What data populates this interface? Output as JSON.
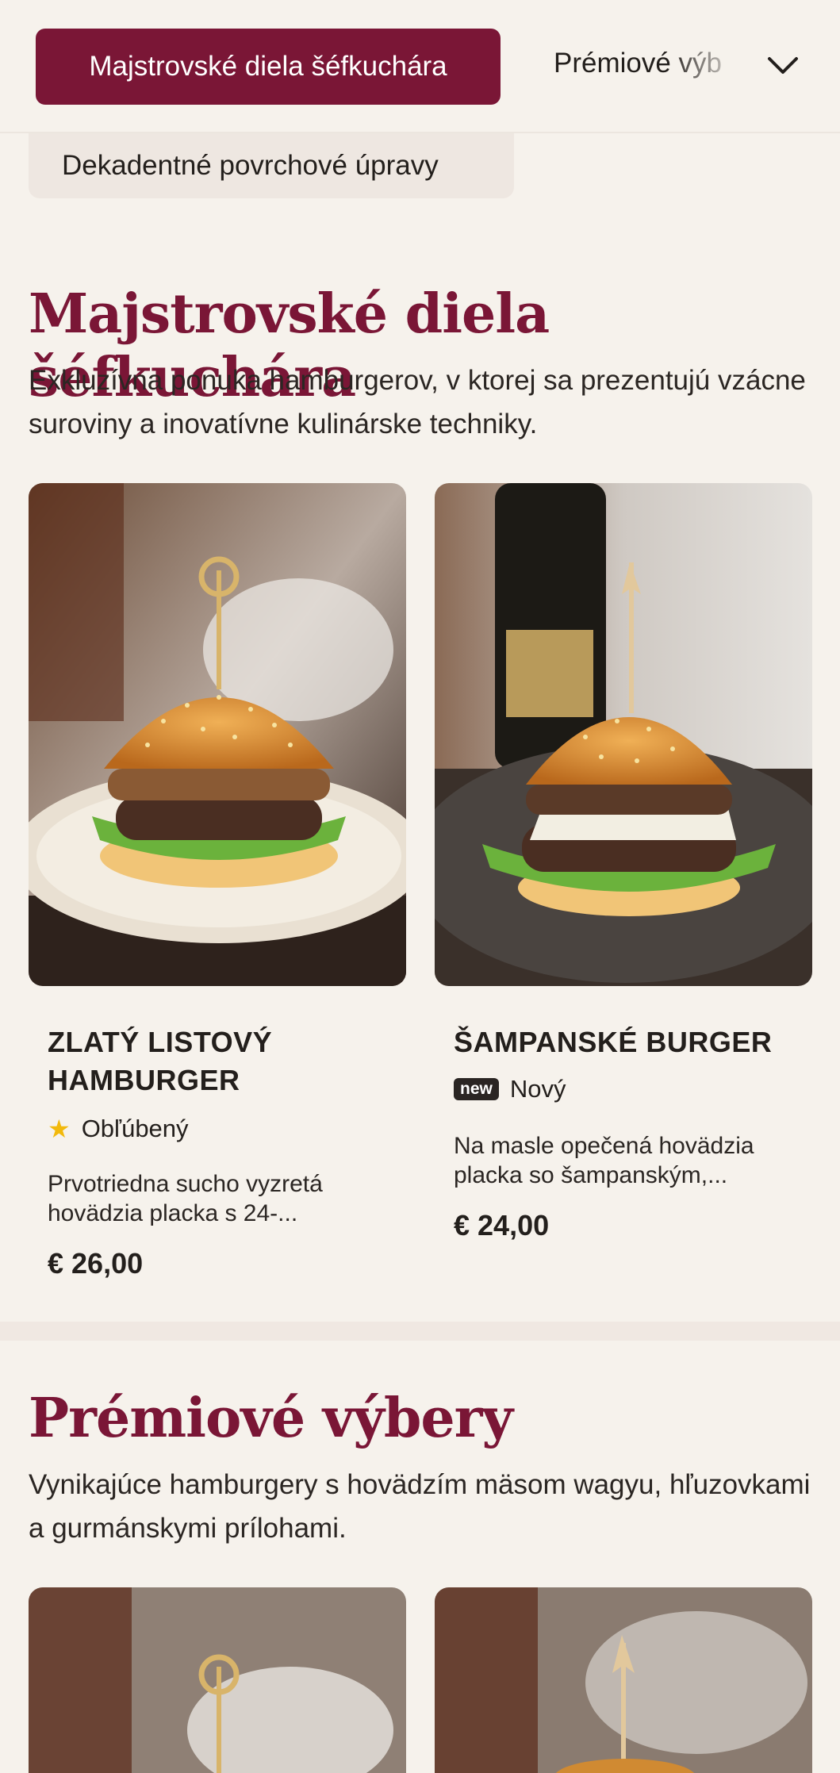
{
  "nav": {
    "active_tab": "Majstrovské diela šéfkuchára",
    "next_tab": "Prémiové výb",
    "prev_chip": "Dekadentné povrchové úpravy",
    "expand_icon": "chevron-down-icon"
  },
  "sections": [
    {
      "title": "Majstrovské diela šéfkuchára",
      "description": "Exkluzívna ponuka hamburgerov, v ktorej sa prezentujú vzácne suroviny a inovatívne kulinárske techniky.",
      "items": [
        {
          "name": "ZLATÝ LISTOVÝ HAMBURGER",
          "badge": "Obľúbený",
          "badge_icon": "star-icon",
          "description": "Prvotriedna sucho vyzretá hovädzia placka s 24-...",
          "price": "€ 26,00"
        },
        {
          "name": "ŠAMPANSKÉ BURGER",
          "badge_tag": "new",
          "badge": "Nový",
          "description": "Na masle opečená hovädzia placka so šampanským,...",
          "price": "€ 24,00"
        }
      ]
    },
    {
      "title": "Prémiové výbery",
      "description": "Vynikajúce hamburgery s hovädzím mäsom wagyu, hľuzovkami a gurmánskymi prílohami."
    }
  ],
  "colors": {
    "accent": "#7a1636",
    "background": "#f6f2ec",
    "star": "#f2b90c"
  }
}
